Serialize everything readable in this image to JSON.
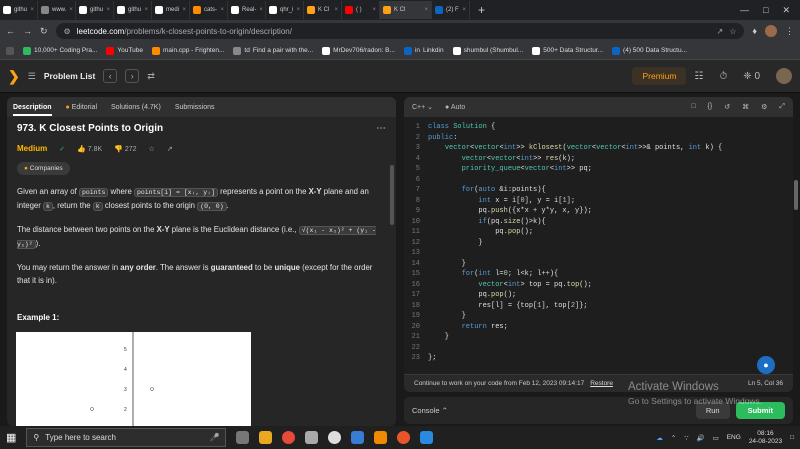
{
  "browser": {
    "tabs": [
      {
        "label": "githu",
        "color": "#ffffff"
      },
      {
        "label": "www.",
        "color": "#888888"
      },
      {
        "label": "githu",
        "color": "#ffffff"
      },
      {
        "label": "githu",
        "color": "#ffffff"
      },
      {
        "label": "medi",
        "color": "#ffffff"
      },
      {
        "label": "cats-",
        "color": "#ff8a00"
      },
      {
        "label": "Real-",
        "color": "#ffffff"
      },
      {
        "label": "qhr_i",
        "color": "#ffffff"
      },
      {
        "label": "K Cl",
        "color": "#ffa116"
      },
      {
        "label": "( )",
        "color": "#ff0000"
      },
      {
        "label": "K Cl",
        "color": "#ffa116",
        "active": true
      },
      {
        "label": "(2) F",
        "color": "#0a66c2"
      }
    ],
    "new_tab": "+",
    "url_domain": "leetcode.com",
    "url_path": "/problems/k-closest-points-to-origin/description/",
    "bookmarks": [
      {
        "label": "10,000+ Coding Pra...",
        "color": "#2cbb5d"
      },
      {
        "label": "YouTube",
        "color": "#ff0000"
      },
      {
        "label": "main.cpp - Frighten...",
        "color": "#ff8a00"
      },
      {
        "label": "Find a pair with the...",
        "color": "#888888",
        "prefix": "td"
      },
      {
        "label": "MrDev706/radon: B...",
        "color": "#ffffff"
      },
      {
        "label": "Linkdin",
        "color": "#0a66c2",
        "prefix": "in"
      },
      {
        "label": "shumbul (Shumbul...",
        "color": "#ffffff"
      },
      {
        "label": "500+ Data Structur...",
        "color": "#ffffff"
      },
      {
        "label": "(4) 500 Data Structu...",
        "color": "#0a66c2"
      }
    ]
  },
  "header": {
    "title": "Problem List",
    "premium": "Premium",
    "fire_count": "0"
  },
  "problem": {
    "tabs": [
      "Description",
      "Editorial",
      "Solutions (4.7K)",
      "Submissions"
    ],
    "title": "973. K Closest Points to Origin",
    "difficulty": "Medium",
    "likes": "7.8K",
    "dislikes": "272",
    "companies": "Companies",
    "desc1_a": "Given an array of ",
    "desc1_code1": "points",
    "desc1_b": " where ",
    "desc1_code2": "points[i] = [xᵢ, yᵢ]",
    "desc1_c": " represents a point on the ",
    "desc1_bold": "X-Y",
    "desc1_d": " plane and an integer ",
    "desc1_code3": "k",
    "desc1_e": ", return the ",
    "desc1_code4": "k",
    "desc1_f": " closest points to the origin ",
    "desc1_code5": "(0, 0)",
    "desc1_g": ".",
    "desc2_a": "The distance between two points on the ",
    "desc2_bold": "X-Y",
    "desc2_b": " plane is the Euclidean distance (i.e., ",
    "desc2_code": "√(x₁ - x₂)² + (y₁ - y₂)²",
    "desc2_c": ").",
    "desc3_a": "You may return the answer in ",
    "desc3_b1": "any order",
    "desc3_b": ". The answer is ",
    "desc3_b2": "guaranteed",
    "desc3_c": " to be ",
    "desc3_b3": "unique",
    "desc3_d": " (except for the order that it is in).",
    "example_label": "Example 1:",
    "example_ticks": [
      "5",
      "4",
      "3",
      "2"
    ]
  },
  "editor": {
    "language": "C++",
    "auto": "Auto",
    "lines": [
      "class Solution {",
      "public:",
      "    vector<vector<int>> kClosest(vector<vector<int>>& points, int k) {",
      "        vector<vector<int>> res(k);",
      "        priority_queue<vector<int>> pq;",
      "",
      "        for(auto &i:points){",
      "            int x = i[0], y = i[1];",
      "            pq.push({x*x + y*y, x, y});",
      "            if(pq.size()>k){",
      "                pq.pop();",
      "            }",
      "",
      "        }",
      "        for(int l=0; l<k; l++){",
      "            vector<int> top = pq.top();",
      "            pq.pop();",
      "            res[l] = {top[1], top[2]};",
      "        }",
      "        return res;",
      "    }",
      "",
      "};"
    ],
    "restore_text": "Continue to work on your code from Feb 12, 2023 09:14:17",
    "restore_button": "Restore",
    "cursor": "Ln 5, Col 36"
  },
  "console": {
    "label": "Console",
    "run": "Run",
    "submit": "Submit"
  },
  "watermark": {
    "line1": "Activate Windows",
    "line2": "Go to Settings to activate Windows."
  },
  "taskbar": {
    "search_placeholder": "Type here to search",
    "lang": "ENG",
    "time": "08:16",
    "date": "24-08-2023"
  }
}
